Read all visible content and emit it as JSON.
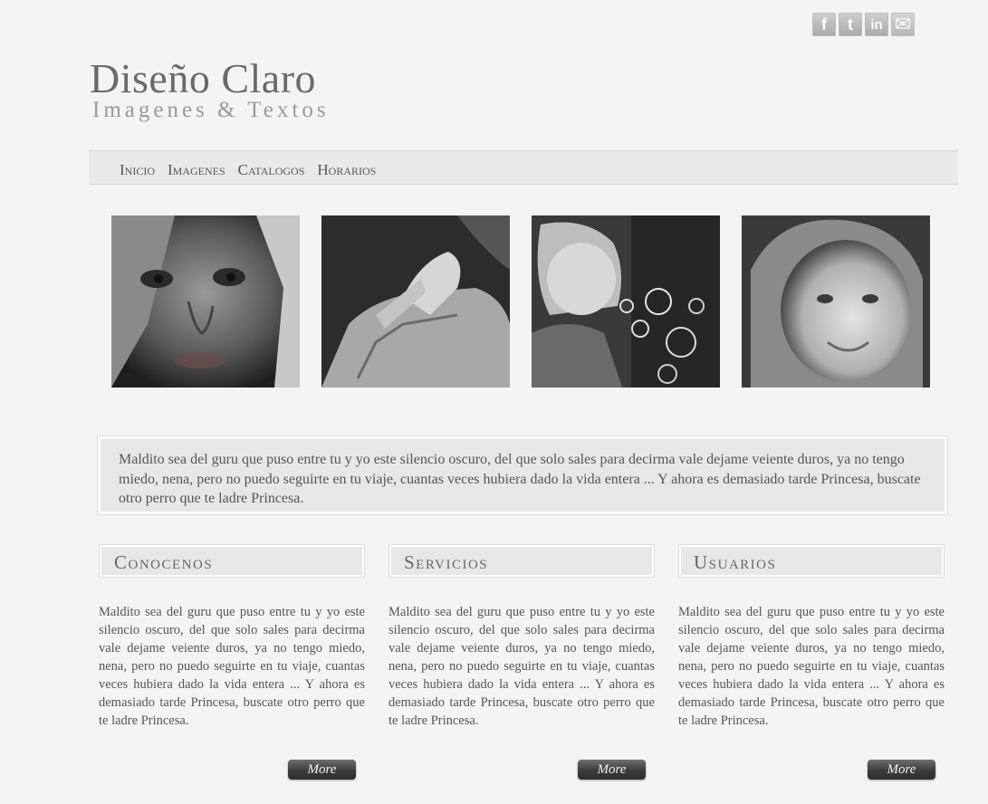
{
  "social": [
    {
      "glyph": "f",
      "icon": "facebook-icon"
    },
    {
      "glyph": "t",
      "icon": "twitter-icon"
    },
    {
      "glyph": "in",
      "icon": "linkedin-icon"
    },
    {
      "glyph": "✉",
      "icon": "mail-icon"
    }
  ],
  "logo": {
    "title": "Diseño Claro",
    "subtitle": "Imagenes & Textos"
  },
  "nav": [
    "Inicio",
    "Imagenes",
    "Catalogos",
    "Horarios"
  ],
  "gallery": [
    "girl-face-photo",
    "hands-photo",
    "bubbles-child-photo",
    "smiling-child-photo"
  ],
  "quote": "Maldito sea del guru que puso entre tu y yo este silencio oscuro, del que solo sales para decirma vale dejame veiente duros, ya no tengo miedo, nena, pero no puedo seguirte en tu viaje, cuantas veces hubiera dado la vida entera ... Y ahora es demasiado tarde Princesa, buscate otro perro que te ladre Princesa.",
  "columns": [
    {
      "title": "Conocenos",
      "text": "Maldito sea del guru que puso entre tu y yo este silencio oscuro, del que solo sales para decirma vale dejame veiente duros, ya no tengo miedo, nena, pero no puedo seguirte en tu viaje, cuantas veces hubiera dado la vida entera ... Y ahora es demasiado tarde Princesa, buscate otro perro que te ladre Princesa.",
      "button": "More"
    },
    {
      "title": "Servicios",
      "text": "Maldito sea del guru que puso entre tu y yo este silencio oscuro, del que solo sales para decirma vale dejame veiente duros, ya no tengo miedo, nena, pero no puedo seguirte en tu viaje, cuantas veces hubiera dado la vida entera ... Y ahora es demasiado tarde Princesa, buscate otro perro que te ladre Princesa.",
      "button": "More"
    },
    {
      "title": "Usuarios",
      "text": "Maldito sea del guru que puso entre tu y yo este silencio oscuro, del que solo sales para decirma vale dejame veiente duros, ya no tengo miedo, nena, pero no puedo seguirte en tu viaje, cuantas veces hubiera dado la vida entera ... Y ahora es demasiado tarde Princesa, buscate otro perro que te ladre Princesa.",
      "button": "More"
    }
  ]
}
